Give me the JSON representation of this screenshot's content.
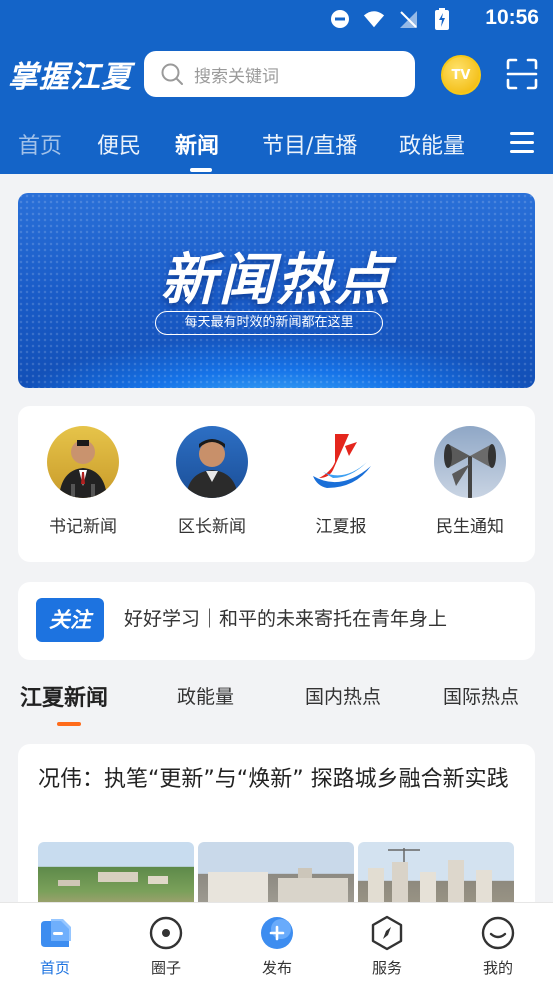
{
  "status_bar": {
    "time": "10:56"
  },
  "header": {
    "app_title": "掌握江夏",
    "search_placeholder": "搜索关键词",
    "tv_label": "TV"
  },
  "nav_tabs": [
    {
      "label": "首页"
    },
    {
      "label": "便民"
    },
    {
      "label": "新闻"
    },
    {
      "label": "节目/直播"
    },
    {
      "label": "政能量"
    }
  ],
  "banner": {
    "title": "新闻热点",
    "subtitle": "每天最有时效的新闻都在这里"
  },
  "quick_links": [
    {
      "label": "书记新闻"
    },
    {
      "label": "区长新闻"
    },
    {
      "label": "江夏报"
    },
    {
      "label": "民生通知"
    }
  ],
  "notice": {
    "tag": "关注",
    "text": "好好学习｜和平的未来寄托在青年身上"
  },
  "sub_tabs": [
    {
      "label": "江夏新闻"
    },
    {
      "label": "政能量"
    },
    {
      "label": "国内热点"
    },
    {
      "label": "国际热点"
    }
  ],
  "article": {
    "title": "况伟：执笔“更新”与“焕新” 探路城乡融合新实践"
  },
  "bottom_nav": [
    {
      "label": "首页",
      "icon": "home-icon"
    },
    {
      "label": "圈子",
      "icon": "circle-icon"
    },
    {
      "label": "发布",
      "icon": "publish-icon"
    },
    {
      "label": "服务",
      "icon": "service-icon"
    },
    {
      "label": "我的",
      "icon": "profile-icon"
    }
  ],
  "colors": {
    "brand_blue": "#1464c8",
    "accent_orange": "#ff6b1a",
    "active_blue": "#1d73e0"
  }
}
